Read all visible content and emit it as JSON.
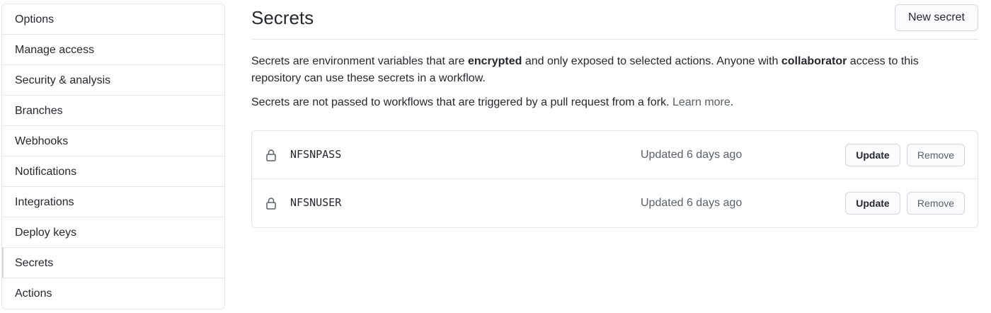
{
  "sidebar": {
    "items": [
      {
        "label": "Options"
      },
      {
        "label": "Manage access"
      },
      {
        "label": "Security & analysis"
      },
      {
        "label": "Branches"
      },
      {
        "label": "Webhooks"
      },
      {
        "label": "Notifications"
      },
      {
        "label": "Integrations"
      },
      {
        "label": "Deploy keys"
      },
      {
        "label": "Secrets",
        "selected": true
      },
      {
        "label": "Actions"
      }
    ]
  },
  "main": {
    "title": "Secrets",
    "new_secret_label": "New secret",
    "description": {
      "p1_part1": "Secrets are environment variables that are ",
      "p1_bold1": "encrypted",
      "p1_part2": " and only exposed to selected actions. Anyone with ",
      "p1_bold2": "collaborator",
      "p1_part3": " access to this repository can use these secrets in a workflow.",
      "p2_text": "Secrets are not passed to workflows that are triggered by a pull request from a fork. ",
      "p2_link": "Learn more",
      "p2_end": "."
    },
    "secrets": [
      {
        "icon": "lock-icon",
        "name": "NFSNPASS",
        "updated": "Updated 6 days ago",
        "update_label": "Update",
        "remove_label": "Remove"
      },
      {
        "icon": "lock-icon",
        "name": "NFSNUSER",
        "updated": "Updated 6 days ago",
        "update_label": "Update",
        "remove_label": "Remove"
      }
    ]
  }
}
